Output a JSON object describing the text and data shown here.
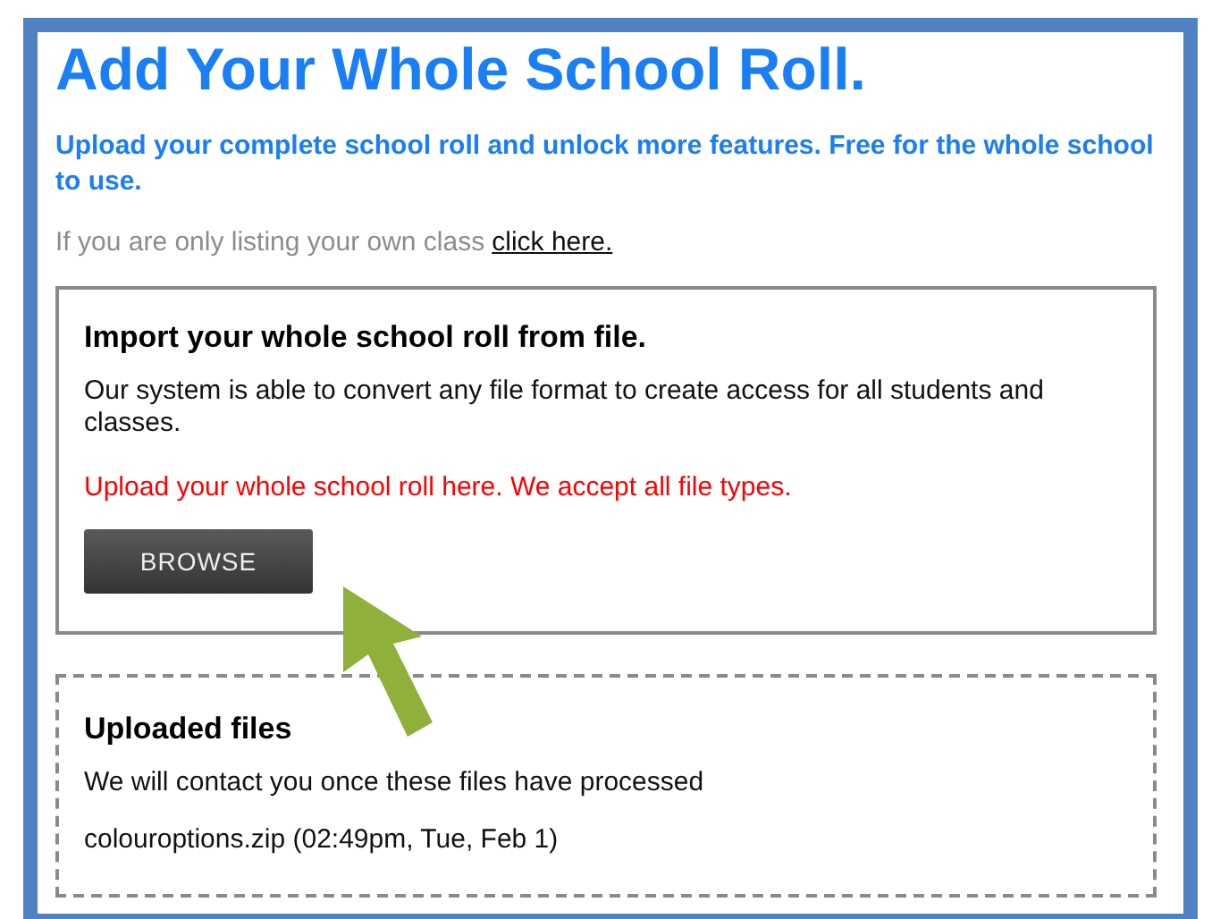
{
  "title": "Add Your Whole School Roll.",
  "intro": "Upload your complete school roll and unlock more features. Free for the whole school to use.",
  "class_note": {
    "text": "If you are only listing your own class",
    "link": "click here."
  },
  "import_panel": {
    "heading": "Import your whole school roll from file.",
    "description": "Our system is able to convert any file format to create access for all students and classes.",
    "notice": "Upload your whole school roll here. We accept all file types.",
    "button": "BROWSE"
  },
  "uploaded_panel": {
    "heading": "Uploaded files",
    "description": "We will contact you once these files have processed",
    "files": [
      {
        "name": "colouroptions.zip (02:49pm, Tue, Feb 1)"
      }
    ]
  }
}
